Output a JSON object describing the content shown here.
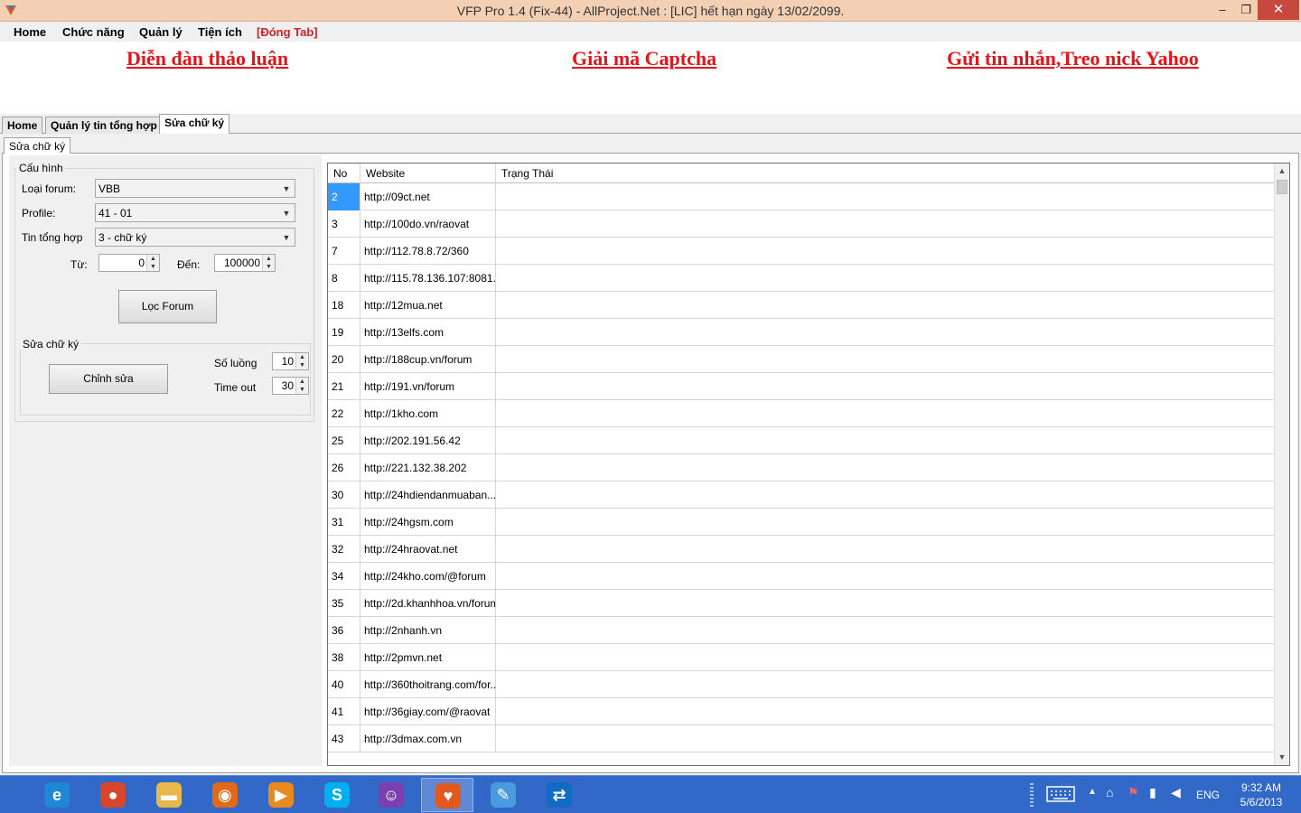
{
  "window": {
    "title": "VFP Pro 1.4 (Fix-44) - AllProject.Net : [LIC] hết hạn ngày 13/02/2099.",
    "minimize_glyph": "–",
    "restore_glyph": "❐",
    "close_glyph": "✕"
  },
  "menu": {
    "items": [
      "Home",
      "Chức năng",
      "Quản lý",
      "Tiện ích",
      "[Đóng Tab]"
    ]
  },
  "banner": {
    "links": [
      "Diễn đàn thảo luận",
      "Giải mã Captcha",
      "Gửi tin nhắn,Treo nick Yahoo"
    ],
    "color": "#e4141a"
  },
  "tabs": [
    "Home",
    "Quản lý tin tổng hợp",
    "Sửa chữ ký"
  ],
  "subtab": "Sửa chữ ký",
  "config": {
    "group_label": "Cấu hình",
    "forum_type_label": "Loại forum:",
    "forum_type_value": "VBB",
    "profile_label": "Profile:",
    "profile_value": "41 - 01",
    "tin_label": "Tin tổng hợp",
    "tin_value": "3 - chữ ký",
    "from_label": "Từ:",
    "from_value": "0",
    "to_label": "Đến:",
    "to_value": "100000",
    "filter_button": "Lọc Forum"
  },
  "edit": {
    "group_label": "Sửa chữ ký",
    "edit_button": "Chỉnh sửa",
    "count_label": "Số luồng",
    "count_value": "10",
    "timeout_label": "Time out",
    "timeout_value": "30"
  },
  "grid": {
    "columns": [
      "No",
      "Website",
      "Trạng Thái"
    ],
    "rows": [
      {
        "no": "2",
        "site": "http://09ct.net",
        "status": ""
      },
      {
        "no": "3",
        "site": "http://100do.vn/raovat",
        "status": ""
      },
      {
        "no": "7",
        "site": "http://112.78.8.72/360",
        "status": ""
      },
      {
        "no": "8",
        "site": "http://115.78.136.107:8081...",
        "status": ""
      },
      {
        "no": "18",
        "site": "http://12mua.net",
        "status": ""
      },
      {
        "no": "19",
        "site": "http://13elfs.com",
        "status": ""
      },
      {
        "no": "20",
        "site": "http://188cup.vn/forum",
        "status": ""
      },
      {
        "no": "21",
        "site": "http://191.vn/forum",
        "status": ""
      },
      {
        "no": "22",
        "site": "http://1kho.com",
        "status": ""
      },
      {
        "no": "25",
        "site": "http://202.191.56.42",
        "status": ""
      },
      {
        "no": "26",
        "site": "http://221.132.38.202",
        "status": ""
      },
      {
        "no": "30",
        "site": "http://24hdiendanmuaban....",
        "status": ""
      },
      {
        "no": "31",
        "site": "http://24hgsm.com",
        "status": ""
      },
      {
        "no": "32",
        "site": "http://24hraovat.net",
        "status": ""
      },
      {
        "no": "34",
        "site": "http://24kho.com/@forum",
        "status": ""
      },
      {
        "no": "35",
        "site": "http://2d.khanhhoa.vn/forum",
        "status": ""
      },
      {
        "no": "36",
        "site": "http://2nhanh.vn",
        "status": ""
      },
      {
        "no": "38",
        "site": "http://2pmvn.net",
        "status": ""
      },
      {
        "no": "40",
        "site": "http://360thoitrang.com/for...",
        "status": ""
      },
      {
        "no": "41",
        "site": "http://36giay.com/@raovat",
        "status": ""
      },
      {
        "no": "43",
        "site": "http://3dmax.com.vn",
        "status": ""
      }
    ]
  },
  "taskbar": {
    "items": [
      {
        "name": "ie-icon",
        "glyph": "e",
        "color": "#1e88d6"
      },
      {
        "name": "chrome-icon",
        "glyph": "●",
        "color": "#d8462c"
      },
      {
        "name": "folder-icon",
        "glyph": "▬",
        "color": "#e8b84a"
      },
      {
        "name": "firefox-icon",
        "glyph": "◉",
        "color": "#e06a18"
      },
      {
        "name": "media-player-icon",
        "glyph": "▶",
        "color": "#e88a1e"
      },
      {
        "name": "skype-icon",
        "glyph": "S",
        "color": "#00aff0"
      },
      {
        "name": "yahoo-messenger-icon",
        "glyph": "☺",
        "color": "#7a3fb0"
      },
      {
        "name": "vfp-app-icon",
        "glyph": "♥",
        "color": "#e05a20"
      },
      {
        "name": "paint-icon",
        "glyph": "✎",
        "color": "#4a9ae0"
      },
      {
        "name": "teamviewer-icon",
        "glyph": "⇄",
        "color": "#0e6cc4"
      }
    ],
    "language": "ENG",
    "time": "9:32 AM",
    "date": "5/6/2013"
  }
}
